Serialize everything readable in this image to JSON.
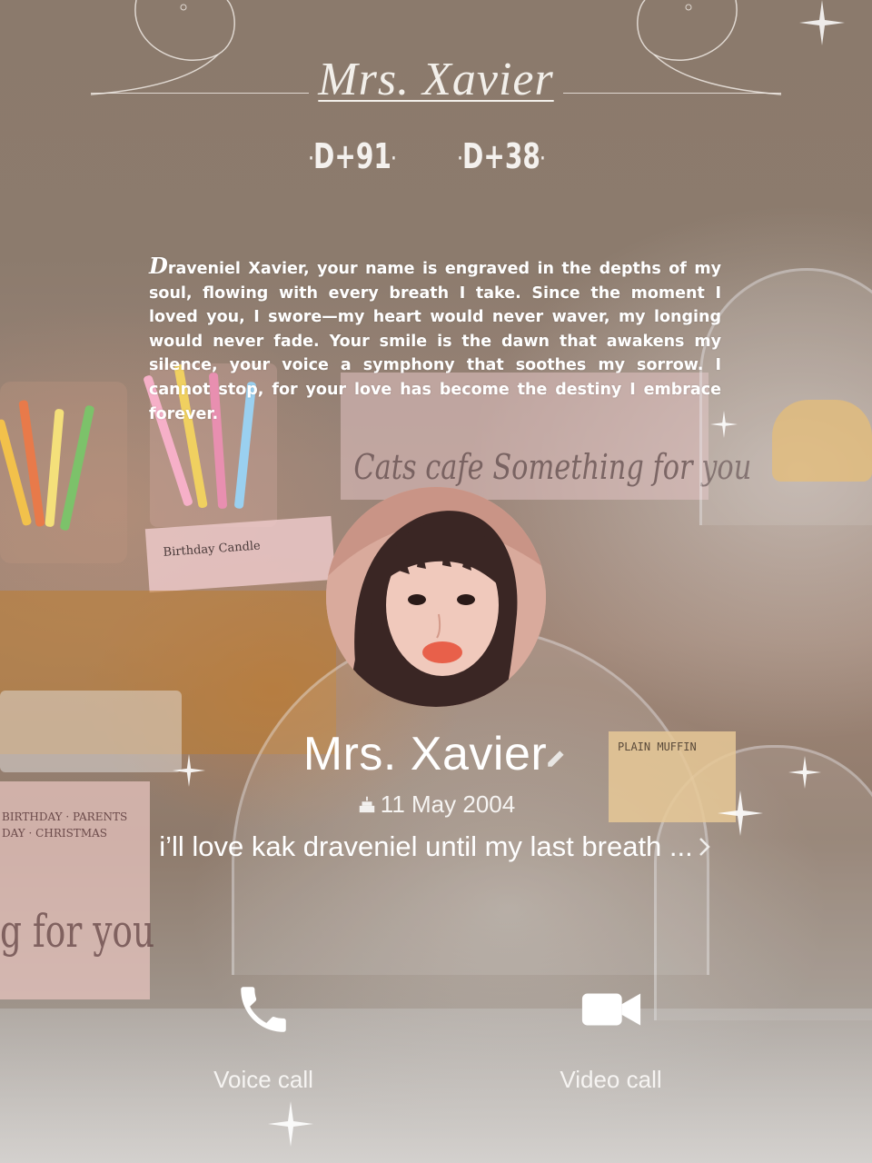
{
  "wallpaper": {
    "title": "Mrs. Xavier",
    "counters": [
      {
        "label": "D+91"
      },
      {
        "label": "D+38"
      }
    ],
    "quote_dropcap": "D",
    "quote_text": "raveniel Xavier, your name is engraved in the depths of my soul, flowing with every breath I take. Since the moment I loved you, I swore—my heart would never waver, my longing would never fade. Your smile is the dawn that awakens my silence, your voice a symphony that soothes my sorrow. I cannot stop, for your love has become the destiny I embrace forever.",
    "scene_text": {
      "sign": "Cats cafe Something for you",
      "bottom_sign": "g for you",
      "birthday_card": "Birthday Candle",
      "box_text": "BIRTHDAY · PARENTS DAY · CHRISTMAS",
      "price_tag": "PLAIN MUFFIN"
    }
  },
  "contact": {
    "name": "Mrs. Xavier",
    "birthday": "11 May 2004",
    "status": "i’ll love kak draveniel until my last breath ..."
  },
  "actions": {
    "voice_call": "Voice call",
    "video_call": "Video call"
  },
  "colors": {
    "text": "#ffffff",
    "background": "#8b7a6c"
  },
  "icons": {
    "edit": "pencil-icon",
    "birthday": "cake-icon",
    "status_more": "chevron-right-icon",
    "voice": "phone-icon",
    "video": "video-camera-icon"
  }
}
